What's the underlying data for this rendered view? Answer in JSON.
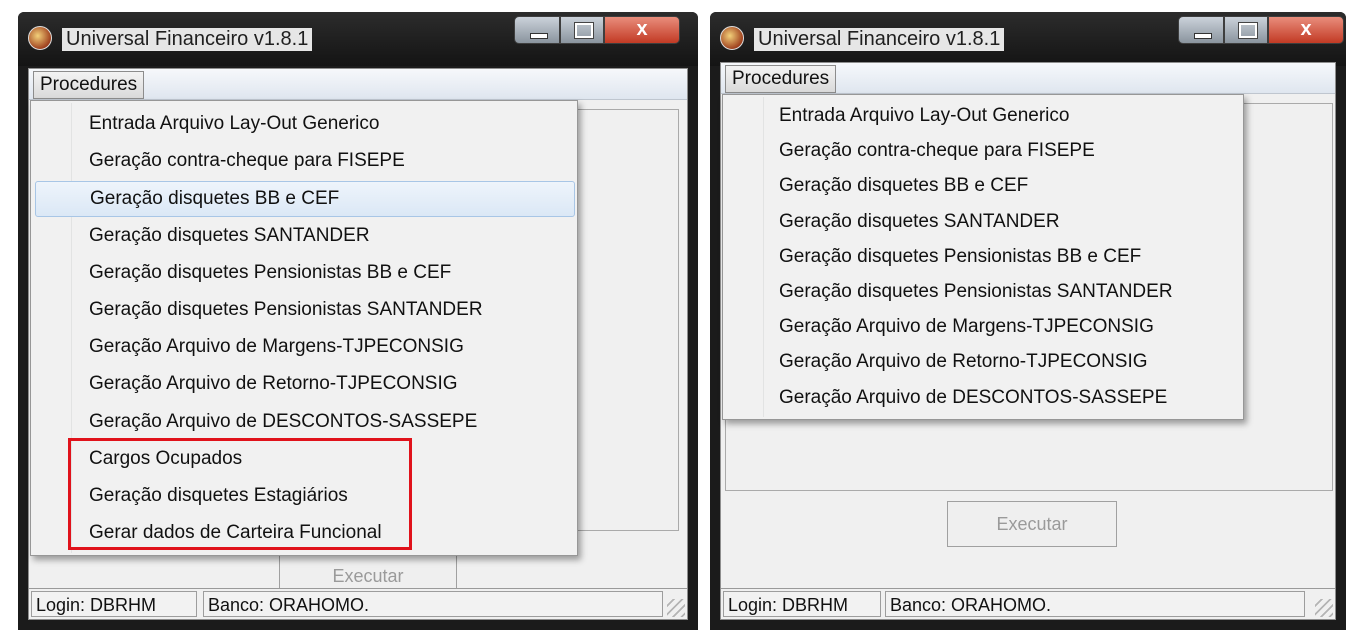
{
  "window_title": "Universal Financeiro v1.8.1",
  "close_glyph": "x",
  "menu": {
    "procedures_label": "Procedures"
  },
  "left_menu_items": [
    "Entrada Arquivo Lay-Out Generico",
    "Geração contra-cheque para FISEPE",
    "Geração disquetes BB e CEF",
    "Geração disquetes SANTANDER",
    "Geração disquetes Pensionistas BB e CEF",
    "Geração disquetes Pensionistas SANTANDER",
    "Geração Arquivo de Margens-TJPECONSIG",
    "Geração Arquivo de Retorno-TJPECONSIG",
    "Geração Arquivo de DESCONTOS-SASSEPE",
    "Cargos Ocupados",
    "Geração disquetes Estagiários",
    "Gerar dados de Carteira Funcional"
  ],
  "right_menu_items": [
    "Entrada Arquivo Lay-Out Generico",
    "Geração contra-cheque para FISEPE",
    "Geração disquetes BB e CEF",
    "Geração disquetes SANTANDER",
    "Geração disquetes Pensionistas BB e CEF",
    "Geração disquetes Pensionistas SANTANDER",
    "Geração Arquivo de Margens-TJPECONSIG",
    "Geração Arquivo de Retorno-TJPECONSIG",
    "Geração Arquivo de DESCONTOS-SASSEPE"
  ],
  "left_highlighted_index": 2,
  "execute_label": "Executar",
  "status": {
    "login": "Login:  DBRHM",
    "banco": "Banco:  ORAHOMO."
  },
  "colors": {
    "highlight_box": "#e0121b",
    "selection": "#dbe8f6"
  }
}
